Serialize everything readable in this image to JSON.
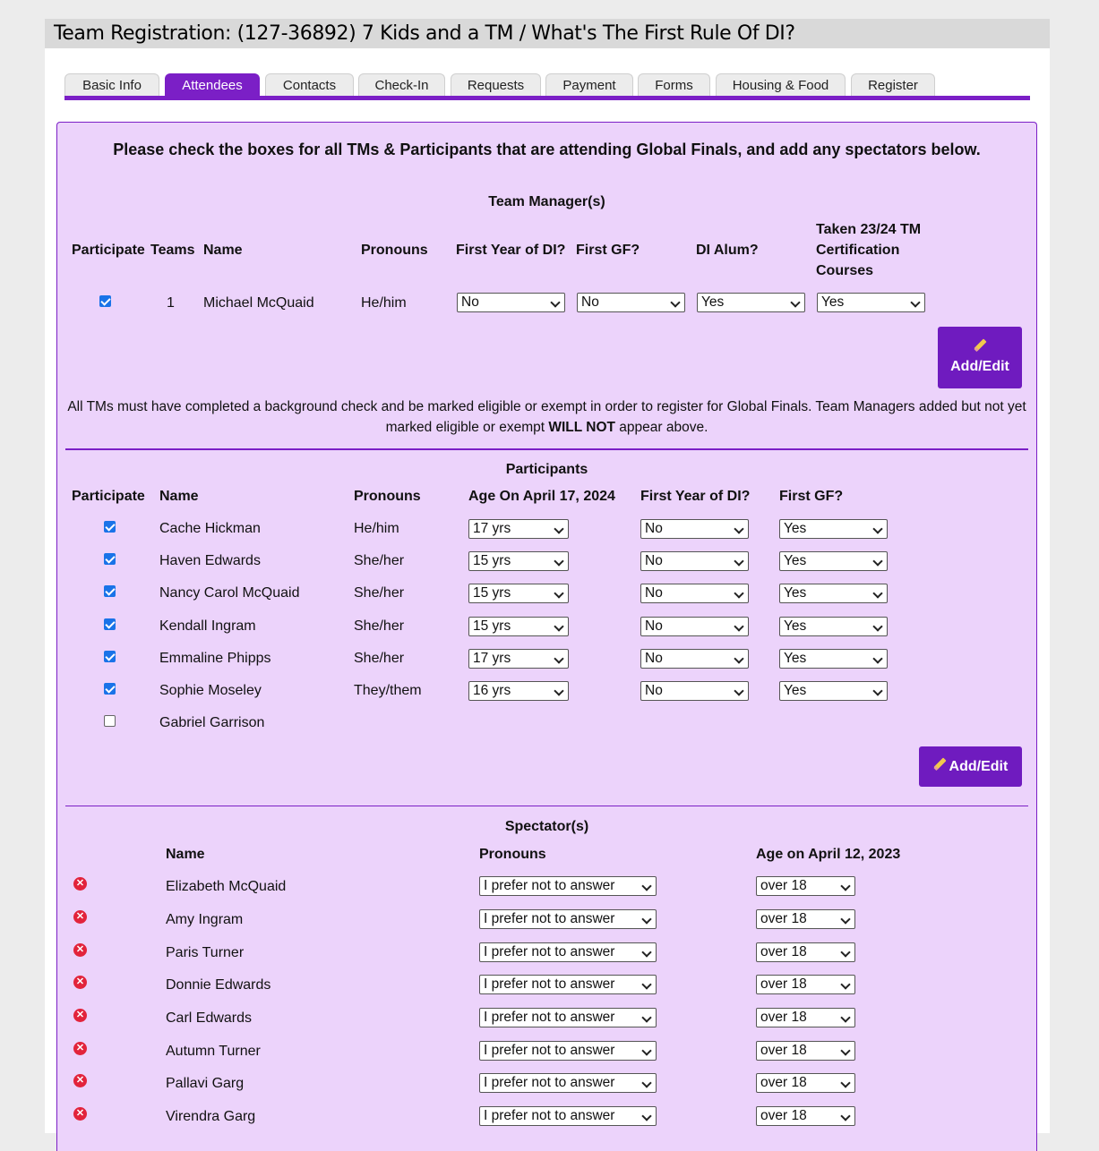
{
  "title": "Team Registration: (127-36892) 7 Kids and a TM / What's The First Rule Of DI?",
  "tabs": [
    "Basic Info",
    "Attendees",
    "Contacts",
    "Check-In",
    "Requests",
    "Payment",
    "Forms",
    "Housing & Food",
    "Register"
  ],
  "active_tab": "Attendees",
  "intro": "Please check the boxes for all TMs & Participants that are attending Global Finals, and add any spectators below.",
  "tm": {
    "title": "Team Manager(s)",
    "headers": {
      "participate": "Participate",
      "teams": "Teams",
      "name": "Name",
      "pronouns": "Pronouns",
      "first_year": "First Year of DI?",
      "first_gf": "First GF?",
      "alum": "DI Alum?",
      "cert_1": "Taken 23/24 TM",
      "cert_2": "Certification",
      "cert_3": "Courses"
    },
    "rows": [
      {
        "checked": true,
        "teams": "1",
        "name": "Michael McQuaid",
        "pronouns": "He/him",
        "first_year": "No",
        "first_gf": "No",
        "alum": "Yes",
        "cert": "Yes"
      }
    ],
    "add_edit": "Add/Edit",
    "note_line1": "All TMs must have completed a background check and be marked eligible or exempt in order to register for Global Finals. Team Managers added but not yet",
    "note_line2_pre": "marked eligible or exempt ",
    "note_line2_bold": "WILL NOT",
    "note_line2_post": " appear above."
  },
  "participants": {
    "title": "Participants",
    "headers": {
      "participate": "Participate",
      "name": "Name",
      "pronouns": "Pronouns",
      "age": "Age On April 17, 2024",
      "first_year": "First Year of DI?",
      "first_gf": "First GF?"
    },
    "rows": [
      {
        "checked": true,
        "name": "Cache Hickman",
        "pronouns": "He/him",
        "age": "17 yrs",
        "first_year": "No",
        "first_gf": "Yes"
      },
      {
        "checked": true,
        "name": "Haven Edwards",
        "pronouns": "She/her",
        "age": "15 yrs",
        "first_year": "No",
        "first_gf": "Yes"
      },
      {
        "checked": true,
        "name": "Nancy Carol McQuaid",
        "pronouns": "She/her",
        "age": "15 yrs",
        "first_year": "No",
        "first_gf": "Yes"
      },
      {
        "checked": true,
        "name": "Kendall Ingram",
        "pronouns": "She/her",
        "age": "15 yrs",
        "first_year": "No",
        "first_gf": "Yes"
      },
      {
        "checked": true,
        "name": "Emmaline Phipps",
        "pronouns": "She/her",
        "age": "17 yrs",
        "first_year": "No",
        "first_gf": "Yes"
      },
      {
        "checked": true,
        "name": "Sophie Moseley",
        "pronouns": "They/them",
        "age": "16 yrs",
        "first_year": "No",
        "first_gf": "Yes"
      },
      {
        "checked": false,
        "name": "Gabriel Garrison"
      }
    ],
    "add_edit": "Add/Edit"
  },
  "spectators": {
    "title": "Spectator(s)",
    "headers": {
      "name": "Name",
      "pronouns": "Pronouns",
      "age": "Age on April 12, 2023"
    },
    "rows": [
      {
        "name": "Elizabeth McQuaid",
        "pronouns": "I prefer not to answer",
        "age": "over 18"
      },
      {
        "name": "Amy Ingram",
        "pronouns": "I prefer not to answer",
        "age": "over 18"
      },
      {
        "name": "Paris Turner",
        "pronouns": "I prefer not to answer",
        "age": "over 18"
      },
      {
        "name": "Donnie Edwards",
        "pronouns": "I prefer not to answer",
        "age": "over 18"
      },
      {
        "name": "Carl Edwards",
        "pronouns": "I prefer not to answer",
        "age": "over 18"
      },
      {
        "name": "Autumn Turner",
        "pronouns": "I prefer not to answer",
        "age": "over 18"
      },
      {
        "name": "Pallavi Garg",
        "pronouns": "I prefer not to answer",
        "age": "over 18"
      },
      {
        "name": "Virendra Garg",
        "pronouns": "I prefer not to answer",
        "age": "over 18"
      }
    ]
  },
  "colors": {
    "accent": "#7b1fc6",
    "panel": "#ecd3fb",
    "remove": "#e2233b"
  }
}
